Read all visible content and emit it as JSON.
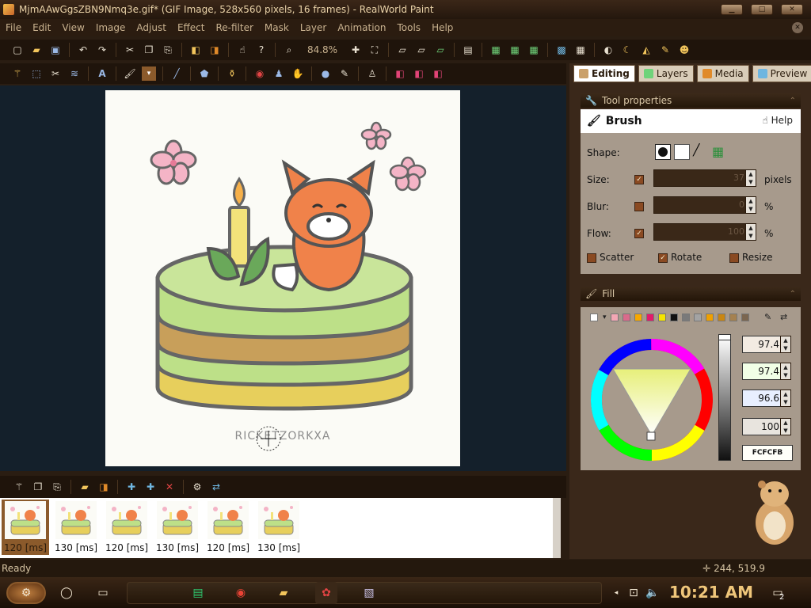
{
  "window": {
    "title": "MjmAAwGgsZBN9Nmq3e.gif* (GIF Image, 528x560 pixels, 16 frames) - RealWorld Paint",
    "buttons": [
      "minimize",
      "maximize",
      "close"
    ]
  },
  "menu": [
    "File",
    "Edit",
    "View",
    "Image",
    "Adjust",
    "Effect",
    "Re-filter",
    "Mask",
    "Layer",
    "Animation",
    "Tools",
    "Help"
  ],
  "toolbar": {
    "zoom": "84.8%"
  },
  "tabs": [
    "Editing",
    "Layers",
    "Media",
    "Preview"
  ],
  "tool_properties": {
    "header": "Tool properties",
    "brush_title": "Brush",
    "help_label": "Help",
    "shape_label": "Shape:",
    "size_label": "Size:",
    "size_value": "37",
    "size_unit": "pixels",
    "blur_label": "Blur:",
    "blur_value": "0",
    "blur_unit": "%",
    "flow_label": "Flow:",
    "flow_value": "100",
    "flow_unit": "%",
    "scatter_label": "Scatter",
    "rotate_label": "Rotate",
    "resize_label": "Resize"
  },
  "fill": {
    "header": "Fill",
    "values": [
      "97.4",
      "97.4",
      "96.6",
      "100"
    ],
    "hex": "FCFCFB",
    "swatches": [
      "#ffffff",
      "#f2a7b4",
      "#d96b8b",
      "#f7a800",
      "#e3196b",
      "#f5e400",
      "#111111",
      "#7a7a7a",
      "#a3a3a3",
      "#f0a000",
      "#c98612",
      "#a58150",
      "#7b6650"
    ]
  },
  "canvas": {
    "watermark": "RICKETZORKXA"
  },
  "frames": [
    {
      "label": "120 [ms]"
    },
    {
      "label": "130 [ms]"
    },
    {
      "label": "120 [ms]"
    },
    {
      "label": "130 [ms]"
    },
    {
      "label": "120 [ms]"
    },
    {
      "label": "130 [ms]"
    }
  ],
  "status": {
    "text": "Ready",
    "coords": "244, 519.9"
  },
  "taskbar": {
    "clock": "10:21 AM",
    "notification_count": "2"
  }
}
